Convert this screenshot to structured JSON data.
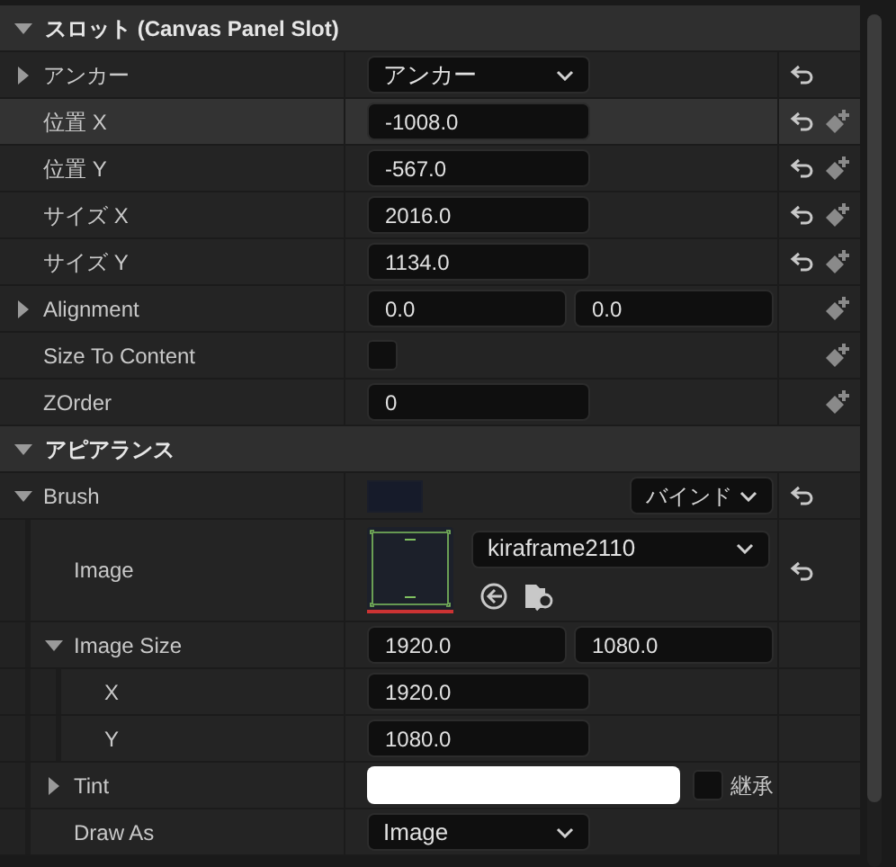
{
  "sections": [
    {
      "title": "スロット (Canvas Panel Slot)",
      "expanded": true,
      "rows": [
        {
          "label": "アンカー",
          "kind": "dropdown",
          "expanded": false,
          "value": "アンカー",
          "reset": true,
          "keyframe": false,
          "highlighted": false
        },
        {
          "label": "位置 X",
          "kind": "number",
          "value": "-1008.0",
          "reset": true,
          "keyframe": true,
          "highlighted": true
        },
        {
          "label": "位置 Y",
          "kind": "number",
          "value": "-567.0",
          "reset": true,
          "keyframe": true,
          "highlighted": false
        },
        {
          "label": "サイズ X",
          "kind": "number",
          "value": "2016.0",
          "reset": true,
          "keyframe": true,
          "highlighted": false
        },
        {
          "label": "サイズ Y",
          "kind": "number",
          "value": "1134.0",
          "reset": true,
          "keyframe": true,
          "highlighted": false
        },
        {
          "label": "Alignment",
          "kind": "vector2",
          "expanded": false,
          "values": [
            "0.0",
            "0.0"
          ],
          "reset": false,
          "keyframe": true,
          "highlighted": false
        },
        {
          "label": "Size To Content",
          "kind": "checkbox",
          "checked": false,
          "reset": false,
          "keyframe": true,
          "highlighted": false
        },
        {
          "label": "ZOrder",
          "kind": "number",
          "value": "0",
          "reset": false,
          "keyframe": true,
          "highlighted": false
        }
      ]
    },
    {
      "title": "アピアランス",
      "expanded": true,
      "rows": [
        {
          "label": "Brush",
          "kind": "brush",
          "expanded": true,
          "binding": "バインド",
          "reset": true,
          "keyframe": false,
          "highlighted": false,
          "children": [
            {
              "label": "Image",
              "kind": "image",
              "value": "kiraframe2110",
              "reset": true,
              "keyframe": false,
              "highlighted": false
            },
            {
              "label": "Image Size",
              "kind": "vector2",
              "expanded": true,
              "values": [
                "1920.0",
                "1080.0"
              ],
              "reset": false,
              "keyframe": false,
              "highlighted": false,
              "children": [
                {
                  "label": "X",
                  "kind": "number",
                  "value": "1920.0",
                  "reset": false,
                  "keyframe": false,
                  "highlighted": false
                },
                {
                  "label": "Y",
                  "kind": "number",
                  "value": "1080.0",
                  "reset": false,
                  "keyframe": false,
                  "highlighted": false
                }
              ]
            },
            {
              "label": "Tint",
              "kind": "color",
              "expanded": false,
              "color": "#ffffff",
              "inherit_label": "継承",
              "inherit_checked": false,
              "reset": false,
              "keyframe": false,
              "highlighted": false
            },
            {
              "label": "Draw As",
              "kind": "dropdown",
              "value": "Image",
              "reset": false,
              "keyframe": false,
              "highlighted": false
            }
          ]
        }
      ]
    }
  ]
}
